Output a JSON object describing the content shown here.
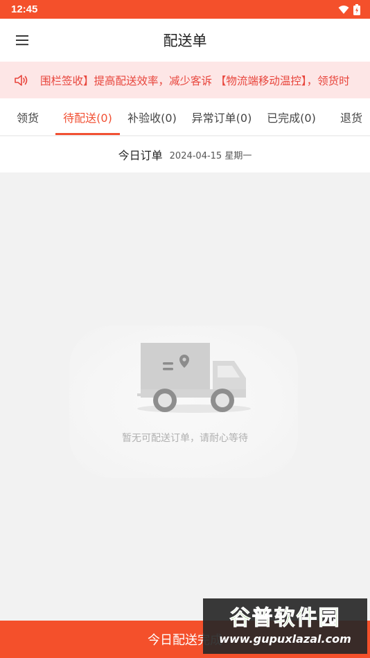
{
  "status_bar": {
    "time": "12:45",
    "icons": [
      "wifi-icon",
      "battery-icon"
    ]
  },
  "app_bar": {
    "title": "配送单",
    "menu_icon": "hamburger-menu-icon"
  },
  "notice": {
    "icon": "speaker-icon",
    "text": "围栏签收】提高配送效率，减少客诉 【物流端移动温控】，领货时"
  },
  "tabs": [
    {
      "label": "领货",
      "active": false
    },
    {
      "label": "待配送(0)",
      "active": true
    },
    {
      "label": "补验收(0)",
      "active": false
    },
    {
      "label": "异常订单(0)",
      "active": false
    },
    {
      "label": "已完成(0)",
      "active": false
    },
    {
      "label": "退货",
      "active": false
    }
  ],
  "date_row": {
    "label": "今日订单",
    "value": "2024-04-15 星期一"
  },
  "empty_state": {
    "icon": "delivery-truck-icon",
    "message": "暂无可配送订单，请耐心等待"
  },
  "bottom_button": {
    "label": "今日配送完成"
  },
  "watermark": {
    "title": "谷普软件园",
    "url": "www.gupuxlazal.com"
  },
  "colors": {
    "accent": "#f4502b",
    "notice_bg": "#fde6e6",
    "notice_text": "#e8453c",
    "tab_active": "#f15033"
  }
}
